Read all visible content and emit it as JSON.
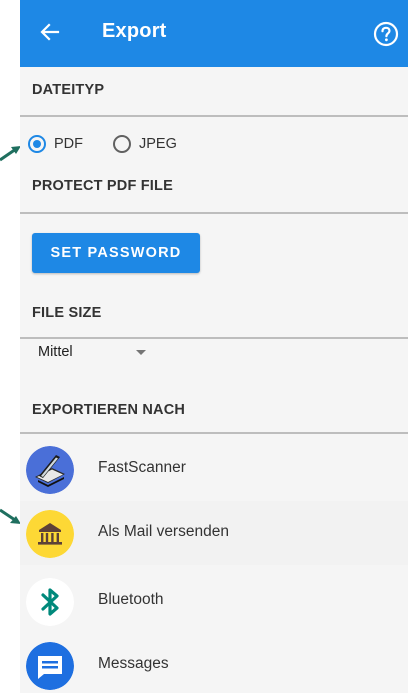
{
  "toolbar": {
    "title": "Export",
    "back_icon": "arrow-left-icon",
    "help_icon": "help-circle-icon"
  },
  "sections": {
    "file_type": "DATEITYP",
    "protect_pdf": "PROTECT PDF FILE",
    "file_size": "FILE SIZE",
    "export_to": "EXPORTIEREN NACH"
  },
  "file_type": {
    "options": [
      {
        "label": "PDF",
        "checked": true
      },
      {
        "label": "JPEG",
        "checked": false
      }
    ]
  },
  "protect": {
    "set_password_label": "SET PASSWORD"
  },
  "file_size": {
    "selected": "Mittel"
  },
  "export_targets": [
    {
      "label": "FastScanner",
      "icon": "scanner-icon"
    },
    {
      "label": "Als Mail versenden",
      "icon": "mail-bank-icon"
    },
    {
      "label": "Bluetooth",
      "icon": "bluetooth-icon"
    },
    {
      "label": "Messages",
      "icon": "messages-icon"
    }
  ],
  "colors": {
    "primary": "#1e88e5",
    "annotation_arrow": "#1f6f5f",
    "mail_icon_bg": "#fdd835"
  }
}
